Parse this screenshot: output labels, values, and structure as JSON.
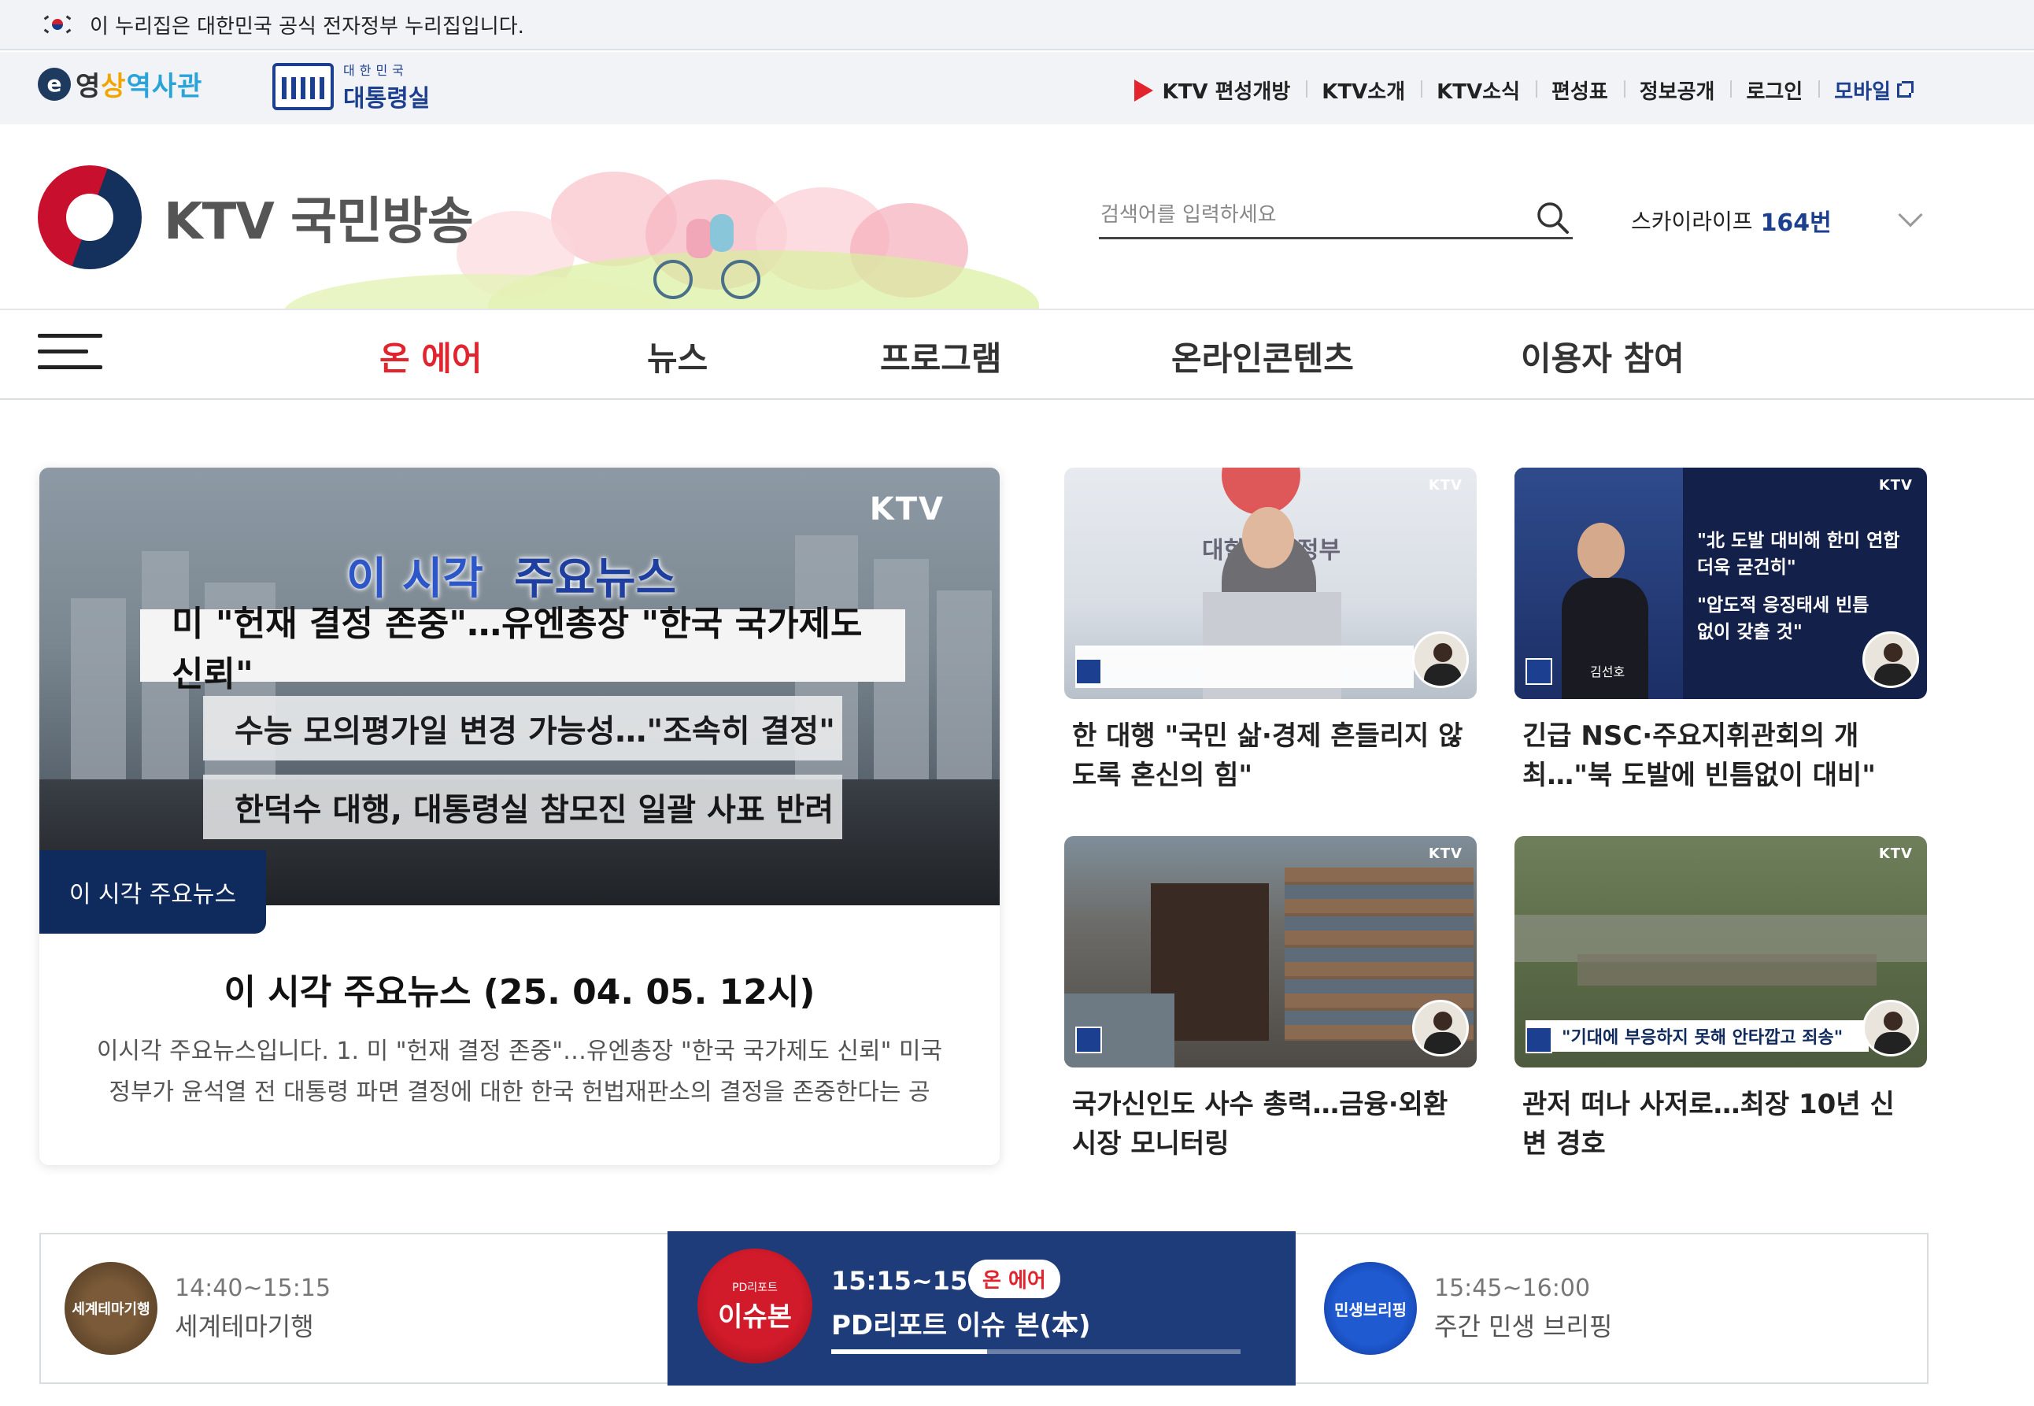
{
  "gov_banner": {
    "text": "이 누리집은 대한민국 공식 전자정부 누리집입니다."
  },
  "util": {
    "ehistory": {
      "e": "e",
      "part1": "영",
      "part2": "상",
      "part3": "역사관"
    },
    "presidential": {
      "small": "대한민국",
      "big": "대통령실"
    },
    "links": [
      {
        "label": "KTV 편성개방",
        "icon": "play-icon"
      },
      {
        "label": "KTV소개"
      },
      {
        "label": "KTV소식"
      },
      {
        "label": "편성표"
      },
      {
        "label": "정보공개"
      },
      {
        "label": "로그인"
      },
      {
        "label": "모바일",
        "icon": "external-link-icon"
      }
    ]
  },
  "header": {
    "logo_text": "KTV 국민방송",
    "search_placeholder": "검색어를 입력하세요",
    "channel_name": "스카이라이프",
    "channel_number": "164번"
  },
  "nav": {
    "items": [
      {
        "label": "온 에어",
        "active": true
      },
      {
        "label": "뉴스"
      },
      {
        "label": "프로그램"
      },
      {
        "label": "온라인콘텐츠"
      },
      {
        "label": "이용자 참여"
      }
    ]
  },
  "featured": {
    "image_mark": "KTV",
    "image_title_a": "이 시각",
    "image_title_b": "주요뉴스",
    "image_headlines": [
      "미 \"헌재 결정 존중\"…유엔총장 \"한국 국가제도 신뢰\"",
      "수능 모의평가일 변경 가능성…\"조속히 결정\"",
      "한덕수 대행, 대통령실 참모진 일괄 사표 반려"
    ],
    "badge": "이 시각 주요뉴스",
    "title": "이 시각 주요뉴스 (25. 04. 05. 12시)",
    "description": "이시각 주요뉴스입니다. 1. 미 \"헌재 결정 존중\"…유엔총장 \"한국 국가제도 신뢰\" 미국 정부가 윤석열 전 대통령 파면 결정에 대한 한국 헌법재판소의 결정을 존중한다는 공식..."
  },
  "cards": [
    {
      "title": "한 대행 \"국민 삶·경제 흔들리지 않도록 혼신의 힘\"",
      "mark": "KTV",
      "caption": "대한민국 정부"
    },
    {
      "title": "긴급 NSC·주요지휘관회의 개최…\"북 도발에 빈틈없이 대비\"",
      "mark": "KTV",
      "quote1": "\"北 도발 대비해 한미 연합 더욱 굳건히\"",
      "quote2": "\"압도적 응징태세 빈틈없이 갖출 것\"",
      "caption": "김선호"
    },
    {
      "title": "국가신인도 사수 총력…금융·외환시장 모니터링",
      "mark": "KTV"
    },
    {
      "title": "관저 떠나 사저로…최장 10년 신변 경호",
      "mark": "KTV",
      "caption": "\"기대에 부응하지 못해 안타깝고 죄송\""
    }
  ],
  "schedule": {
    "prev": {
      "time": "14:40~15:15",
      "title": "세계테마기행",
      "thumb_label": "세계테마기행"
    },
    "current": {
      "time": "15:15~15:45",
      "badge": "온 에어",
      "title": "PD리포트 이슈 본(本)",
      "thumb_small": "PD리포트",
      "thumb_big": "이슈본",
      "progress": 0.38
    },
    "next": {
      "time": "15:45~16:00",
      "title": "주간 민생 브리핑",
      "thumb_label": "민생브리핑"
    }
  },
  "colors": {
    "accent_red": "#e0252f",
    "navy": "#1d3f8f",
    "badge_navy": "#0f2a5c",
    "onair_bg": "#1f3c7a"
  }
}
